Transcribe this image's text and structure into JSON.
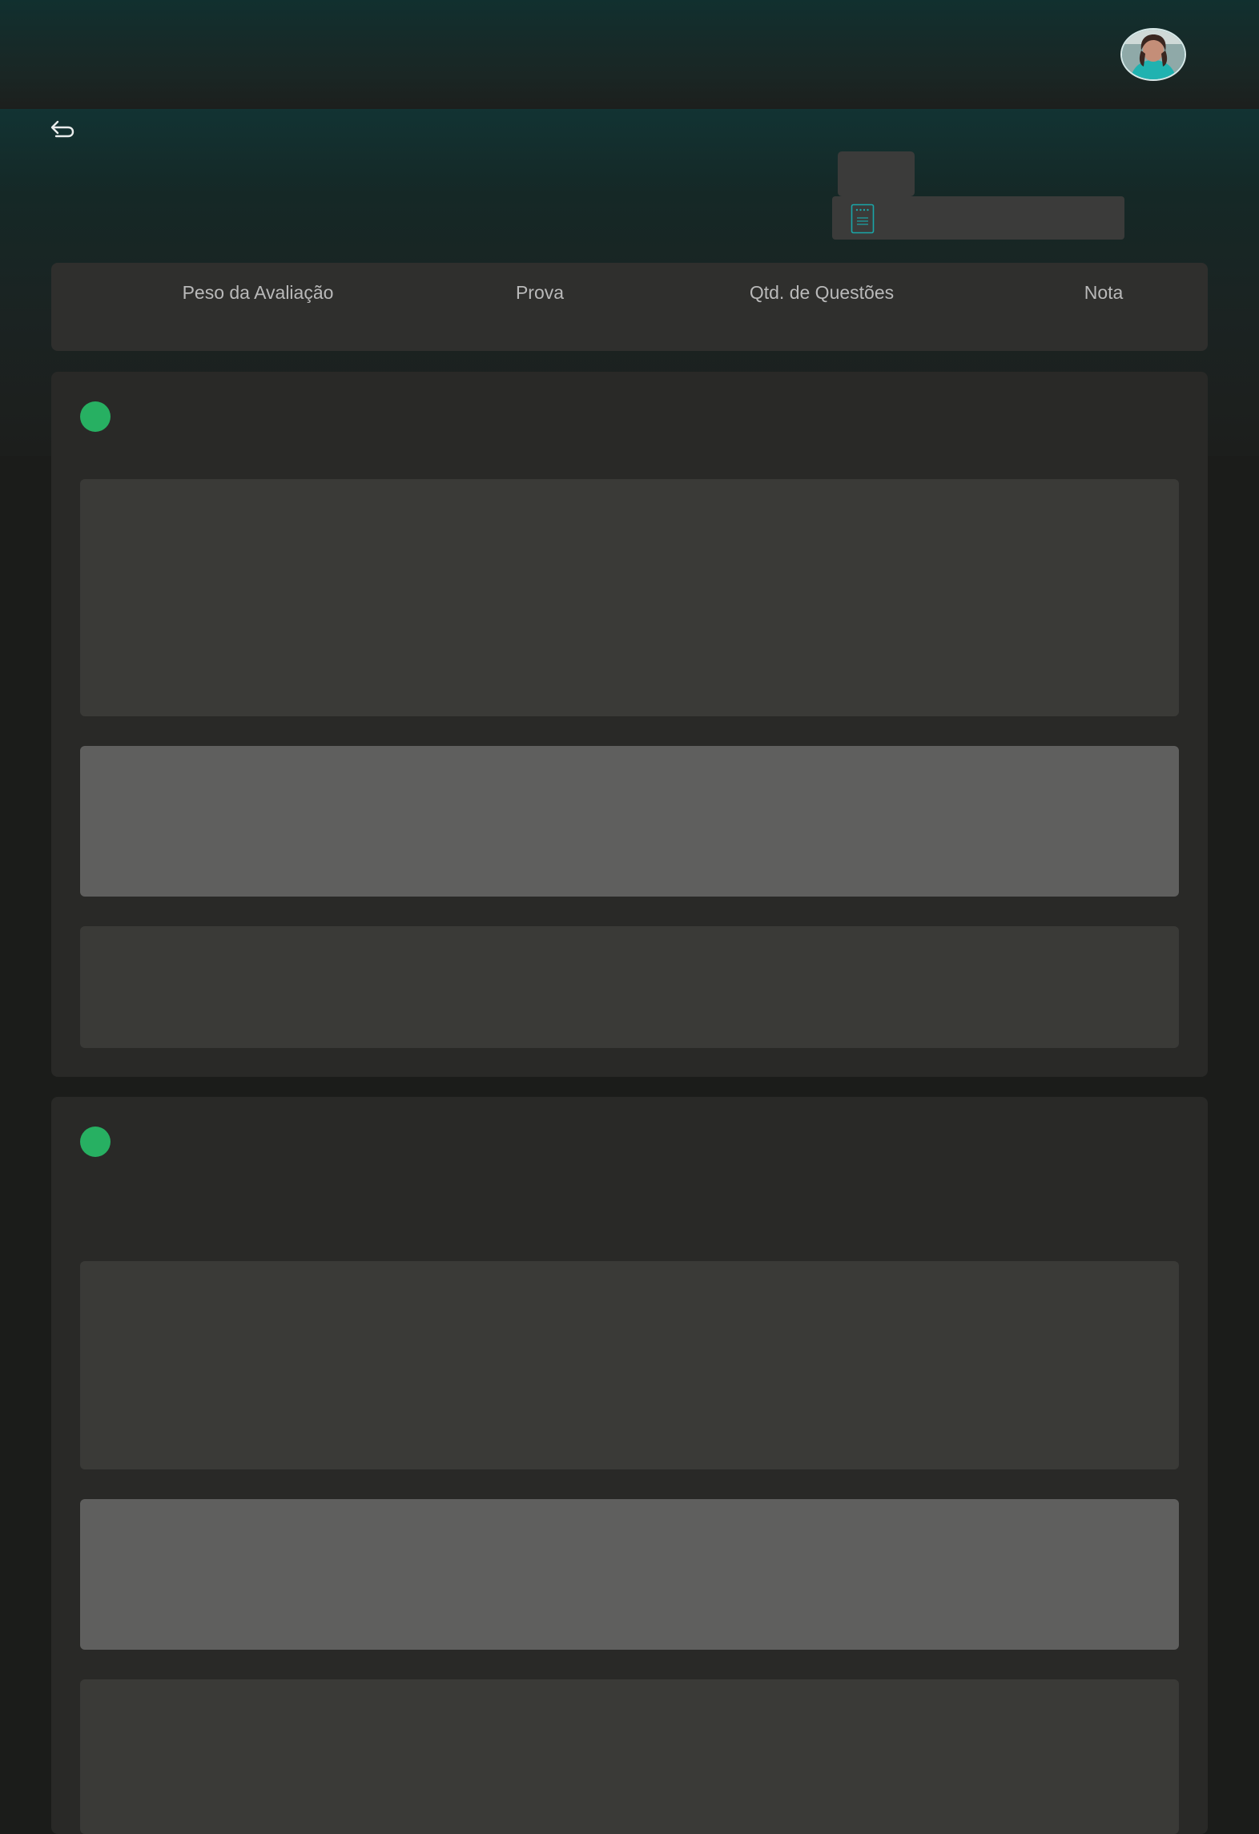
{
  "header": {
    "avatar_icon": "user-avatar-photo"
  },
  "nav": {
    "back_icon": "return-arrow-icon"
  },
  "assessment": {
    "document_icon": "document-list-icon"
  },
  "summary": {
    "columns": [
      {
        "label": "Peso da Avaliação"
      },
      {
        "label": "Prova"
      },
      {
        "label": "Qtd. de Questões"
      },
      {
        "label": "Nota"
      }
    ]
  },
  "colors": {
    "accent_teal": "#1aa6a8",
    "status_green": "#27b062",
    "page_background": "#1b1c1a",
    "card_background": "#292927"
  }
}
